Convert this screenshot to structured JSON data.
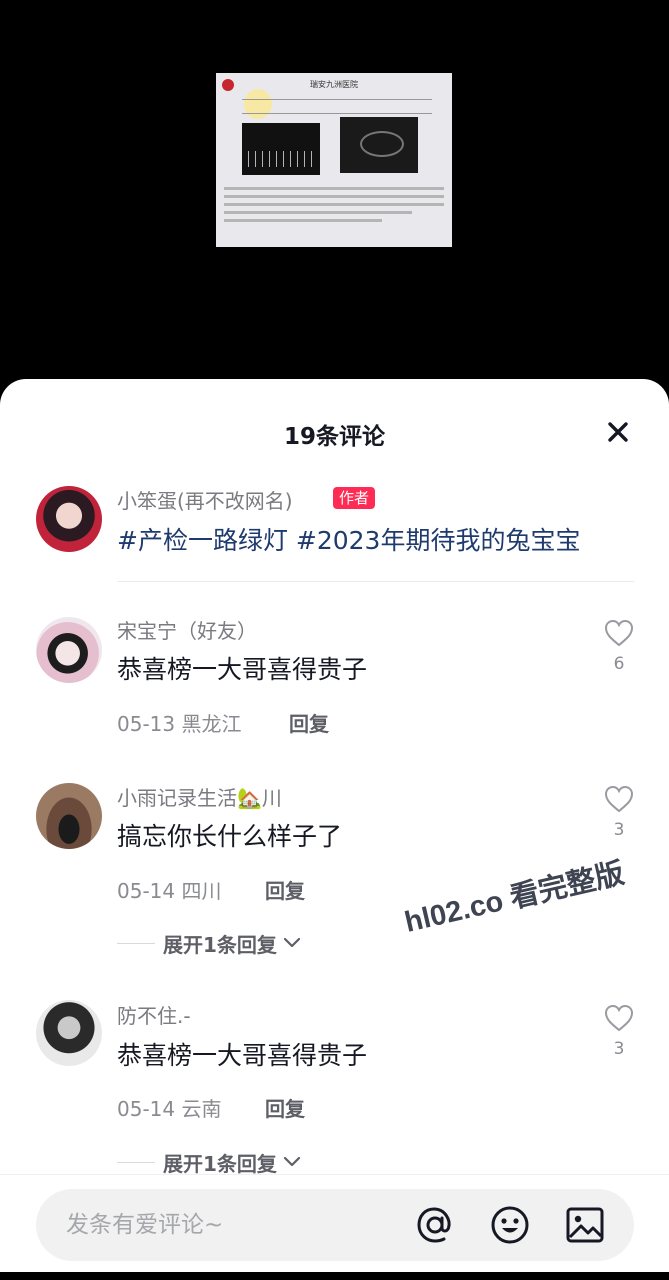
{
  "sheet": {
    "title": "19条评论"
  },
  "photo": {
    "hospital_name": "瑞安九洲医院"
  },
  "author_post": {
    "username": "小笨蛋(再不改网名)",
    "badge": "作者",
    "tags": "#产检一路绿灯 #2023年期待我的兔宝宝"
  },
  "comments": [
    {
      "username": "宋宝宁（好友）",
      "text": "恭喜榜一大哥喜得贵子",
      "date": "05-13",
      "location": "黑龙江",
      "reply_label": "回复",
      "likes": "6"
    },
    {
      "username": "小雨记录生活🏡川",
      "text": "搞忘你长什么样子了",
      "date": "05-14",
      "location": "四川",
      "reply_label": "回复",
      "likes": "3",
      "expand_label": "展开1条回复"
    },
    {
      "username": "防不住.-",
      "text": "恭喜榜一大哥喜得贵子",
      "date": "05-14",
      "location": "云南",
      "reply_label": "回复",
      "likes": "3",
      "expand_label": "展开1条回复"
    }
  ],
  "watermark": "hl02.co 看完整版",
  "input": {
    "placeholder": "发条有爱评论~"
  },
  "icons": {
    "close": "close-icon",
    "like": "heart-outline-icon",
    "expand": "chevron-down-icon",
    "mention": "at-icon",
    "emoji": "emoji-icon",
    "image": "image-icon"
  },
  "colors": {
    "author_badge": "#fe2c55",
    "hashtag": "#1f3b6e",
    "text": "#161823",
    "muted": "#8a8b91"
  }
}
